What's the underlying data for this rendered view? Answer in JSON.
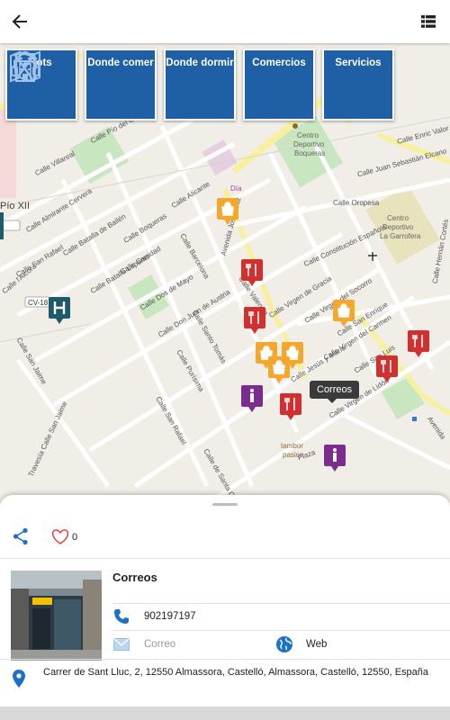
{
  "toolbar": {
    "back_icon": "arrow-left-icon",
    "list_icon": "list-view-icon"
  },
  "categories": [
    {
      "label": "Tots",
      "icon": "map-icon"
    },
    {
      "label": "Donde comer",
      "icon": "fork-knife-icon"
    },
    {
      "label": "Donde dormir",
      "icon": "hotel-building-icon"
    },
    {
      "label": "Comercios",
      "icon": "shopping-bag-icon"
    },
    {
      "label": "Servicios",
      "icon": "headset-icon"
    }
  ],
  "map": {
    "tooltip": "Correos",
    "labels": {
      "pio": "Pío XII",
      "cv18": "CV-18",
      "cv": "CV-",
      "dia": "Día",
      "centro_boqueras_1": "Centro",
      "centro_boqueras_2": "Deportivo",
      "centro_boqueras_3": "Boqueras",
      "centro_garrofera_1": "Centro",
      "centro_garrofera_2": "Deportivo",
      "centro_garrofera_3": "La Garrofera",
      "tambor_1": "tambor",
      "tambor_2": "pasion",
      "s1": "Calle Pío del Calvari",
      "s2": "Calle Villareal",
      "s3": "Calle Almirante Cervera",
      "s4": "Calle Batalla de Bailén",
      "s5": "Calle San Rafael",
      "s6": "Calle Boqueras",
      "s7": "Calle Batalla Lepanto",
      "s8": "Calle Carridad",
      "s9": "Calle Dos de Mayo",
      "s10": "Calle Don Juan de Austria",
      "s11": "Calle Alicante",
      "s12": "Calle Barcelona",
      "s13": "Calle Santo Tomás",
      "s14": "Calle Purísima",
      "s15": "Calle San Rafael",
      "s16": "Calle de Santa Quiteria",
      "s17": "Calle Constitución Española",
      "s18": "Calle Virgen de Gracia",
      "s19": "Calle Virgen del Socorro",
      "s20": "Calle Virgen del Carmen",
      "s21": "Calle San Enrique",
      "s22": "Calle San Luis",
      "s23": "Calle Virgen de Lidón",
      "s24": "Calle Oropesa",
      "s25": "Calle Juan Sebastián Elcano",
      "s26": "Calle Enric Valor",
      "s27": "Calle Hernán Cortés",
      "s28": "Avenida",
      "s29": "Calle San Jaime",
      "s30": "Travesía Calle San Jaime",
      "s31": "Calle Jesús y María",
      "s32": "Avenida José Ortiz",
      "s33": "Calle Pío XII",
      "s34": "Plaza",
      "s35": "Calle l'Alcora",
      "s36": "Calle Valencia"
    }
  },
  "detail": {
    "likes": "0",
    "title": "Correos",
    "phone": "902197197",
    "email_placeholder": "Correo",
    "web_label": "Web",
    "address": "Carrer de Sant Lluc, 2, 12550 Almassora, Castelló, Almassora, Castelló, 12550, España"
  },
  "colors": {
    "category_blue": "#1f5fa6",
    "accent_blue": "#1a73c9",
    "restaurant_red": "#d32f2f",
    "shop_orange": "#f4a72c",
    "info_purple": "#7b2d8e",
    "hotel_teal": "#1f5a6b"
  }
}
